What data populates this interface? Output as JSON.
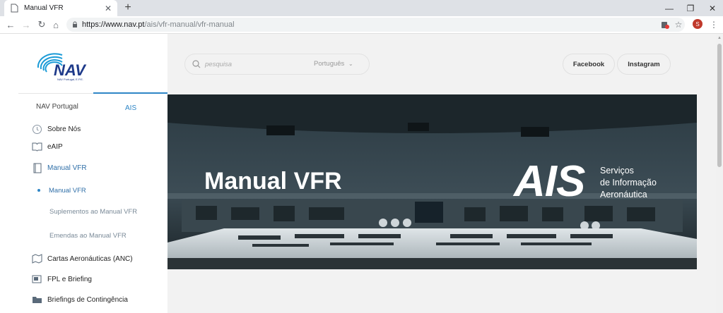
{
  "browser": {
    "tab_title": "Manual VFR",
    "tab_close": "✕",
    "new_tab": "+",
    "url_domain": "https://www.nav.pt",
    "url_path": "/ais/vfr-manual/vfr-manual",
    "profile_initial": "S",
    "icons": {
      "back": "back-arrow-icon",
      "forward": "forward-arrow-icon",
      "reload": "reload-icon",
      "home": "home-icon",
      "lock": "lock-icon",
      "extension": "extension-icon",
      "bookmark": "star-icon",
      "menu": "menu-dots-icon"
    }
  },
  "sidebar": {
    "tabs": [
      {
        "label": "NAV Portugal",
        "active": false
      },
      {
        "label": "AIS",
        "active": true
      }
    ],
    "items": [
      {
        "label": "Sobre Nós",
        "icon": "clock-icon"
      },
      {
        "label": "eAIP",
        "icon": "book-icon"
      },
      {
        "label": "Manual VFR",
        "icon": "manual-icon",
        "active": true
      },
      {
        "label": "Cartas Aeronáuticas (ANC)",
        "icon": "map-icon"
      },
      {
        "label": "FPL e Briefing",
        "icon": "briefing-icon"
      },
      {
        "label": "Briefings de Contingência",
        "icon": "folder-icon"
      }
    ],
    "subitems": [
      {
        "label": "Manual VFR",
        "active": true
      },
      {
        "label": "Suplementos ao Manual VFR",
        "active": false
      },
      {
        "label": "Emendas ao Manual VFR",
        "active": false
      }
    ]
  },
  "header": {
    "search_placeholder": "pesquisa",
    "language": "Português",
    "social": [
      "Facebook",
      "Instagram"
    ]
  },
  "banner": {
    "title": "Manual VFR",
    "ais_word": "AIS",
    "ais_tagline": [
      "Serviços",
      "de Informação",
      "Aeronáutica"
    ]
  },
  "colors": {
    "accent": "#2f86c6",
    "main_bg": "#f2f2f2"
  }
}
